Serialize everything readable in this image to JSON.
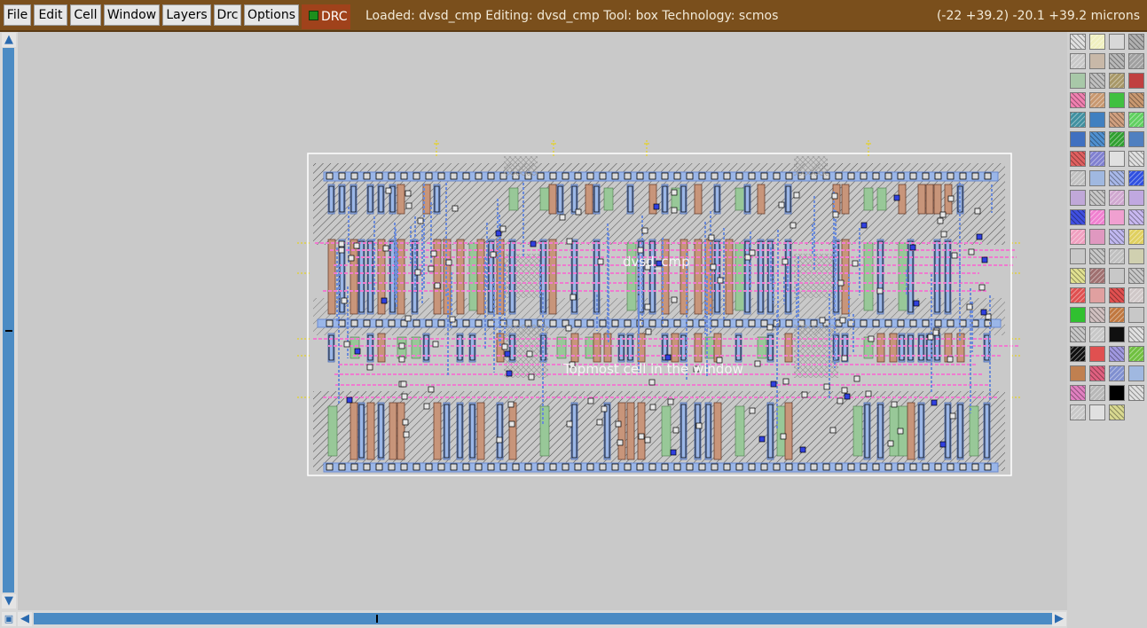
{
  "menubar": {
    "file": "File",
    "edit": "Edit",
    "cell": "Cell",
    "window": "Window",
    "layers": "Layers",
    "drc": "Drc",
    "options": "Options"
  },
  "drc_indicator": {
    "label": "DRC",
    "led_color": "#1c8f1c"
  },
  "status": {
    "text": "Loaded: dvsd_cmp Editing: dvsd_cmp Tool: box  Technology: scmos",
    "coords": "(-22 +39.2) -20.1 +39.2 microns"
  },
  "layout": {
    "cell_label": "dvsd_cmp",
    "window_label": "Topmost cell in the window"
  },
  "scrollbars": {
    "up": "▲",
    "down": "▼",
    "left": "◀",
    "right": "▶"
  },
  "palette_colors": [
    "#e0e0e0",
    "#f0f0c0",
    "#d8d8d8",
    "#b0b0b0",
    "#c8c8c8",
    "#c8b8a8",
    "#b8b8b8",
    "#a0a0a0",
    "#a8c8a8",
    "#c0c0c0",
    "#a89868",
    "#c04040",
    "#f080b0",
    "#c89870",
    "#40c040",
    "#c89870",
    "#4090a0",
    "#4080c0",
    "#d0a080",
    "#60d060",
    "#4070c0",
    "#5090d0",
    "#30a030",
    "#5080c0",
    "#e06060",
    "#8080d0",
    "#e0e0e0",
    "#e0e0e0",
    "#c0c0c0",
    "#a0b8e0",
    "#a8b8e8",
    "#3050e0",
    "#c0a8d8",
    "#c8c8c8",
    "#d0a8d0",
    "#c0a8e0",
    "#4050e0",
    "#f080d0",
    "#f0a0d0",
    "#c8b8f0",
    "#f0a0c0",
    "#e098c0",
    "#c0b8f0",
    "#e0d060",
    "#c8c8c8",
    "#c8c8c8",
    "#c0c0c0",
    "#d0d0b0",
    "#e0e090",
    "#a07070",
    "#c8c8c8",
    "#c8c8c8",
    "#e05050",
    "#e0a0a0",
    "#e05050",
    "#d0c8c8",
    "#30c030",
    "#d0c0c0",
    "#c07840",
    "#c8c8c8",
    "#c8c8c8",
    "#c8c8c8",
    "#101010",
    "#e0e0e0",
    "#101010",
    "#e05050",
    "#a098e0",
    "#70c040",
    "#c08050",
    "#e06080",
    "#8090d0",
    "#a0b8e0",
    "#e080c0",
    "#b8b8b8",
    "#000000",
    "#e0e0e0",
    "#c8c8c8",
    "#e0e0e0",
    "#d8d890"
  ]
}
